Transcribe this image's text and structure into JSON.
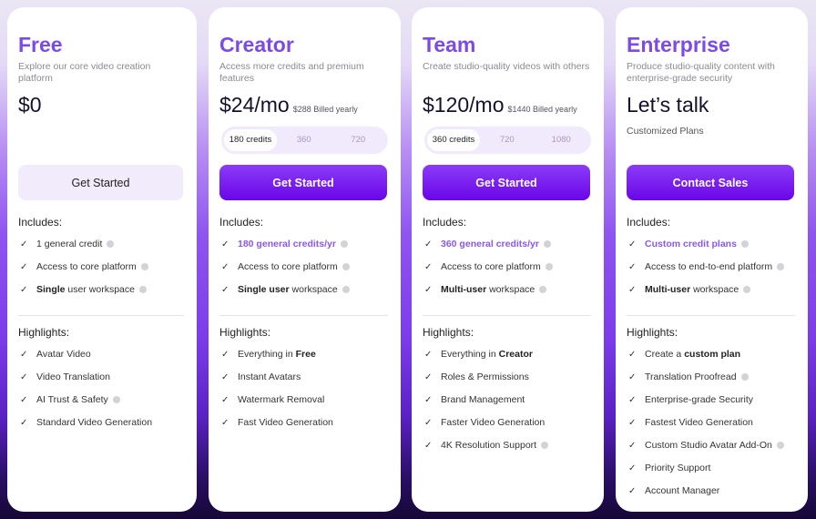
{
  "colors": {
    "accent": "#7a4be8",
    "button": "#6a05e8"
  },
  "labels": {
    "includes": "Includes:",
    "highlights": "Highlights:"
  },
  "plans": [
    {
      "name": "Free",
      "desc": "Explore our core video creation platform",
      "price": "$0",
      "billed": "",
      "button": "Get Started",
      "button_style": "light",
      "includes": [
        [
          {
            "t": "1 general credit"
          }
        ],
        [
          {
            "t": "Access to core platform"
          }
        ],
        [
          {
            "t": "Single",
            "s": "b"
          },
          {
            "t": " user workspace"
          }
        ]
      ],
      "includes_info": [
        true,
        true,
        true
      ],
      "highlights": [
        [
          {
            "t": "Avatar Video"
          }
        ],
        [
          {
            "t": "Video Translation"
          }
        ],
        [
          {
            "t": "AI Trust & Safety"
          }
        ],
        [
          {
            "t": "Standard Video Generation"
          }
        ]
      ],
      "highlights_info": [
        false,
        false,
        true,
        false
      ]
    },
    {
      "name": "Creator",
      "desc": "Access more credits and premium features",
      "price": "$24/mo",
      "billed": "$288 Billed yearly",
      "button": "Get Started",
      "credits": {
        "options": [
          "180 credits",
          "360",
          "720"
        ],
        "selected": 0
      },
      "includes": [
        [
          {
            "t": "180 general credits/yr",
            "s": "hl"
          }
        ],
        [
          {
            "t": "Access to core platform"
          }
        ],
        [
          {
            "t": "Single user",
            "s": "b"
          },
          {
            "t": " workspace"
          }
        ]
      ],
      "includes_info": [
        true,
        true,
        true
      ],
      "highlights": [
        [
          {
            "t": "Everything in "
          },
          {
            "t": "Free",
            "s": "b"
          }
        ],
        [
          {
            "t": "Instant Avatars"
          }
        ],
        [
          {
            "t": "Watermark Removal"
          }
        ],
        [
          {
            "t": "Fast Video Generation"
          }
        ]
      ],
      "highlights_info": [
        false,
        false,
        false,
        false
      ]
    },
    {
      "name": "Team",
      "desc": "Create studio-quality videos with others",
      "price": "$120/mo",
      "billed": "$1440 Billed yearly",
      "button": "Get Started",
      "credits": {
        "options": [
          "360 credits",
          "720",
          "1080"
        ],
        "selected": 0
      },
      "includes": [
        [
          {
            "t": "360 general credits/yr",
            "s": "hl"
          }
        ],
        [
          {
            "t": "Access to core platform"
          }
        ],
        [
          {
            "t": "Multi-user",
            "s": "b"
          },
          {
            "t": " workspace"
          }
        ]
      ],
      "includes_info": [
        true,
        true,
        true
      ],
      "highlights": [
        [
          {
            "t": "Everything in "
          },
          {
            "t": "Creator",
            "s": "b"
          }
        ],
        [
          {
            "t": "Roles & Permissions"
          }
        ],
        [
          {
            "t": "Brand Management"
          }
        ],
        [
          {
            "t": "Faster Video Generation"
          }
        ],
        [
          {
            "t": "4K Resolution Support"
          }
        ]
      ],
      "highlights_info": [
        false,
        false,
        false,
        false,
        true
      ]
    },
    {
      "name": "Enterprise",
      "desc": "Produce studio-quality content with enterprise-grade security",
      "price": "Let’s talk",
      "subtitle": "Customized Plans",
      "billed": "",
      "button": "Contact Sales",
      "includes": [
        [
          {
            "t": "Custom credit plans",
            "s": "hl"
          }
        ],
        [
          {
            "t": "Access to end-to-end platform"
          }
        ],
        [
          {
            "t": "Multi-user",
            "s": "b"
          },
          {
            "t": " workspace"
          }
        ]
      ],
      "includes_info": [
        true,
        true,
        true
      ],
      "highlights": [
        [
          {
            "t": "Create a "
          },
          {
            "t": "custom plan",
            "s": "b"
          }
        ],
        [
          {
            "t": "Translation Proofread"
          }
        ],
        [
          {
            "t": "Enterprise-grade Security"
          }
        ],
        [
          {
            "t": "Fastest Video Generation"
          }
        ],
        [
          {
            "t": "Custom Studio Avatar Add-On"
          }
        ],
        [
          {
            "t": "Priority Support"
          }
        ],
        [
          {
            "t": "Account Manager"
          }
        ]
      ],
      "highlights_info": [
        false,
        true,
        false,
        false,
        true,
        false,
        false
      ]
    }
  ]
}
